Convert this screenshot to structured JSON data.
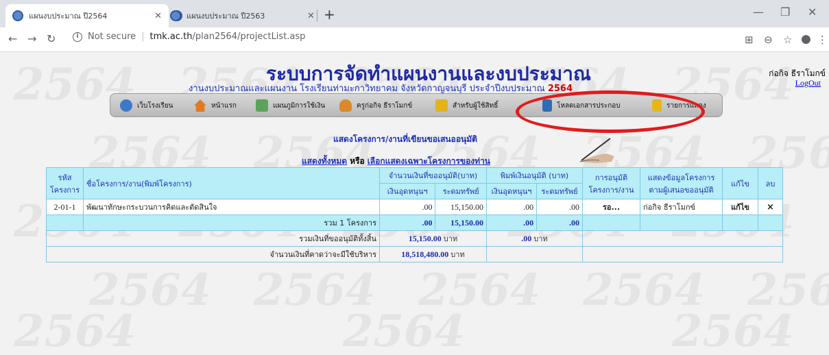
{
  "browser": {
    "tabs": [
      {
        "title": "แผนงบประมาณ ปี2564",
        "active": true
      },
      {
        "title": "แผนงบประมาณ ปี2563",
        "active": false
      }
    ],
    "security": "Not secure",
    "host": "tmk.ac.th",
    "path": "/plan2564/projectList.asp"
  },
  "header": {
    "title": "ระบบการจัดทำแผนงานและงบประมาณ",
    "subtitle": "งานงบประมาณและแผนงาน โรงเรียนท่ามะกาวิทยาคม  จังหวัดกาญจนบุรี  ประจำปีงบประมาณ",
    "year": "2564",
    "user": "ก่อกิจ ธีราโมกข์",
    "logout": "LogOut",
    "watermark": "2564"
  },
  "menu": [
    {
      "label": "เว็บโรงเรียน",
      "icon": "school-logo-icon",
      "color": "#3e78c9"
    },
    {
      "label": "หน้าแรก",
      "icon": "home-icon",
      "color": "#e07b24"
    },
    {
      "label": "แผนภูมิการใช้เงิน",
      "icon": "chart-icon",
      "color": "#5ba35b"
    },
    {
      "label": "ครูก่อกิจ ธีราโมกข์",
      "icon": "user-icon",
      "color": "#d98a2b"
    },
    {
      "label": "สำหรับผู้ใช้สิทธิ์",
      "icon": "lock-icon",
      "color": "#e3b21f"
    },
    {
      "label": "โหลดเอกสารประกอบ",
      "icon": "book-icon",
      "color": "#2f6cb5"
    },
    {
      "label": "รายการแสดง",
      "icon": "folder-icon",
      "color": "#e6b51c"
    }
  ],
  "section": {
    "heading": "แสดงโครงการ/งานที่เขียนขอเสนออนุมัติ",
    "show_all": "แสดงทั้งหมด",
    "or": "หรือ",
    "show_mine": "เลือกแสดงเฉพาะโครงการของท่าน"
  },
  "table": {
    "h_code": "รหัส\nโครงการ",
    "h_name": "ชื่อโครงการ/งาน",
    "h_print": "(พิมพ์โครงการ)",
    "h_request": "จำนวนเงินที่ขออนุมัติ(บาท)",
    "h_print_approve": "พิมพ์เงินอนุมัติ (บาท)",
    "h_subsidy": "เงินอุดหนุนฯ",
    "h_mobilize": "ระดมทรัพย์",
    "h_approval": "การอนุมัติ\nโครงการ/งาน",
    "h_requester": "แสดงข้อมูลโครงการ\nตามผู้เสนอขออนุมัติ",
    "h_edit": "แก้ไข",
    "h_delete": "ลบ",
    "rows": [
      {
        "code": "2-01-1",
        "name": "พัฒนาทักษะกระบวนการคิดและตัดสินใจ",
        "req_subsidy": ".00",
        "req_mobilize": "15,150.00",
        "app_subsidy": ".00",
        "app_mobilize": ".00",
        "status": "รอ...",
        "requester": "ก่อกิจ ธีราโมกข์",
        "edit": "แก้ไข",
        "delete": "×"
      }
    ],
    "summary": {
      "label": "รวม  1  โครงการ",
      "req_subsidy": ".00",
      "req_mobilize": "15,150.00",
      "app_subsidy": ".00",
      "app_mobilize": ".00"
    },
    "total_requested": {
      "label": "รวมเงินที่ขออนุมัติทั้งสิ้น",
      "amount": "15,150.00",
      "unit": "บาท",
      "approved": ".00",
      "approved_unit": "บาท"
    },
    "expected": {
      "label": "จำนวนเงินที่คาดว่าจะมีใช้บริหาร",
      "amount": "18,518,480.00",
      "unit": "บาท"
    }
  }
}
